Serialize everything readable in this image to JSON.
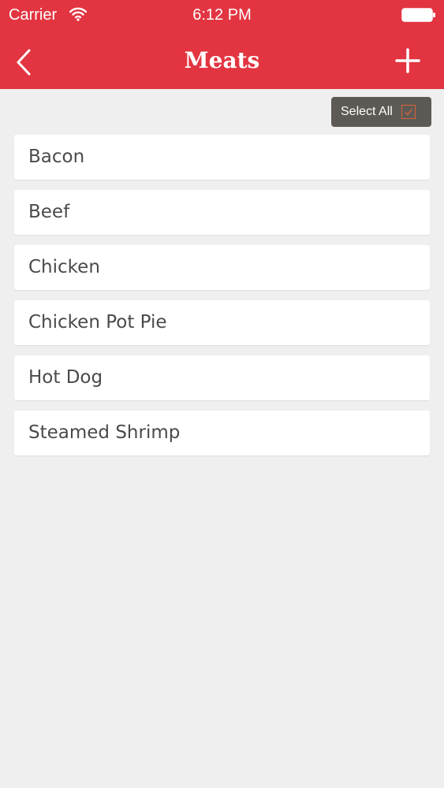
{
  "status_bar": {
    "carrier": "Carrier",
    "time": "6:12 PM"
  },
  "nav": {
    "title": "Meats",
    "back_icon": "chevron-left-icon",
    "add_icon": "plus-icon"
  },
  "select_all": {
    "label": "Select All",
    "checked": true
  },
  "items": [
    {
      "label": "Bacon"
    },
    {
      "label": "Beef"
    },
    {
      "label": "Chicken"
    },
    {
      "label": "Chicken Pot Pie"
    },
    {
      "label": "Hot Dog"
    },
    {
      "label": "Steamed Shrimp"
    }
  ],
  "colors": {
    "header": "#e23541",
    "background": "#efefef",
    "select_all_bg": "#5d5a55",
    "checkbox_accent": "#d9623a"
  }
}
